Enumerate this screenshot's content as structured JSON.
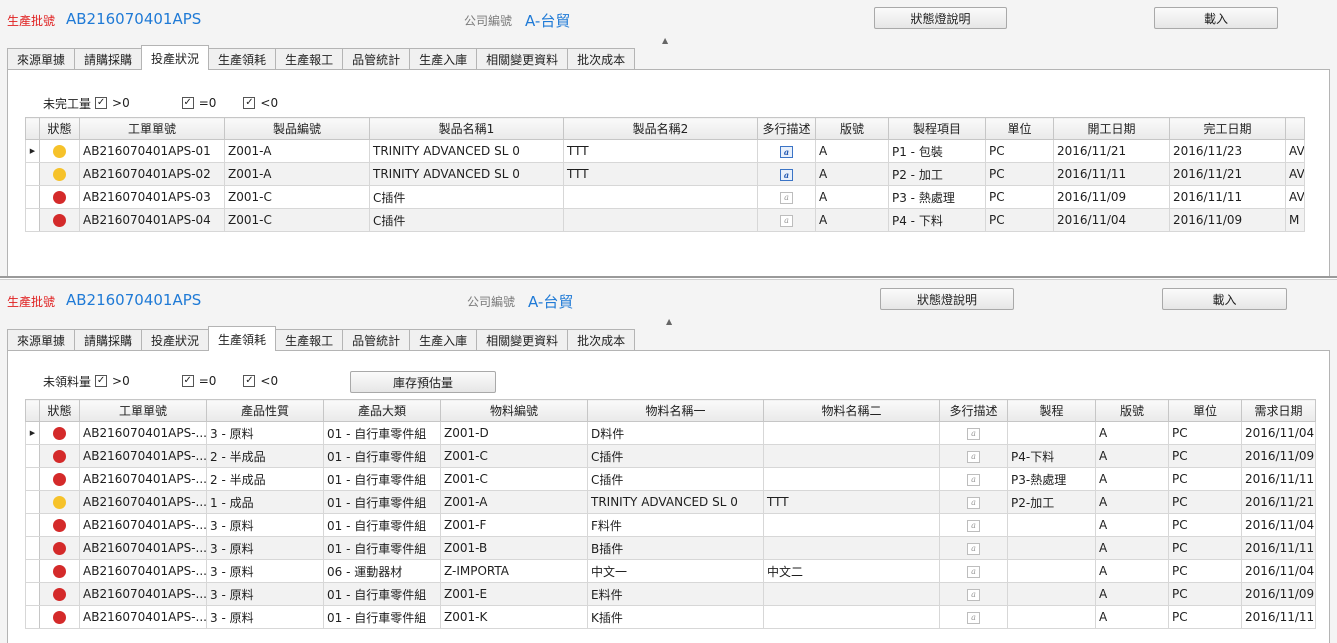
{
  "colors": {
    "red_label": "#e02020",
    "blue_value": "#1f7ad6",
    "status_red": "#d42a2a",
    "status_yellow": "#f6c22a"
  },
  "top": {
    "batch_label": "生產批號",
    "batch_value": "AB216070401APS",
    "company_label": "公司編號",
    "company_value": "A-台貿",
    "status_button": "狀態燈說明",
    "load_button": "載入",
    "tabs": [
      "來源單據",
      "請購採購",
      "投產狀況",
      "生產領耗",
      "生產報工",
      "品管統計",
      "生產入庫",
      "相關變更資料",
      "批次成本"
    ],
    "active_tab": 2,
    "filter": {
      "label": "未完工量",
      "opt1": ">0",
      "opt2": "=0",
      "opt3": "<0",
      "opt1_checked": true,
      "opt2_checked": true,
      "opt3_checked": true
    },
    "columns": [
      "狀態",
      "工單單號",
      "製品編號",
      "製品名稱1",
      "製品名稱2",
      "多行描述",
      "版號",
      "製程項目",
      "單位",
      "開工日期",
      "完工日期",
      ""
    ],
    "rows": [
      {
        "status": "yellow",
        "cells": [
          "AB216070401APS-01",
          "Z001-A",
          "TRINITY ADVANCED SL 0",
          "TTT",
          "A",
          "P1 - 包裝",
          "PC",
          "2016/11/21",
          "2016/11/23",
          "AV"
        ],
        "desc": "filled"
      },
      {
        "status": "yellow",
        "cells": [
          "AB216070401APS-02",
          "Z001-A",
          "TRINITY ADVANCED SL 0",
          "TTT",
          "A",
          "P2 - 加工",
          "PC",
          "2016/11/11",
          "2016/11/21",
          "AV"
        ],
        "desc": "filled"
      },
      {
        "status": "red",
        "cells": [
          "AB216070401APS-03",
          "Z001-C",
          "C插件",
          "",
          "A",
          "P3 - 熱處理",
          "PC",
          "2016/11/09",
          "2016/11/11",
          "AV"
        ],
        "desc": "empty"
      },
      {
        "status": "red",
        "cells": [
          "AB216070401APS-04",
          "Z001-C",
          "C插件",
          "",
          "A",
          "P4 - 下料",
          "PC",
          "2016/11/04",
          "2016/11/09",
          "M"
        ],
        "desc": "empty"
      }
    ]
  },
  "bottom": {
    "batch_label": "生產批號",
    "batch_value": "AB216070401APS",
    "company_label": "公司編號",
    "company_value": "A-台貿",
    "status_button": "狀態燈說明",
    "load_button": "載入",
    "tabs": [
      "來源單據",
      "請購採購",
      "投產狀況",
      "生產領耗",
      "生產報工",
      "品管統計",
      "生產入庫",
      "相關變更資料",
      "批次成本"
    ],
    "active_tab": 3,
    "filter": {
      "label": "未領料量",
      "opt1": ">0",
      "opt2": "=0",
      "opt3": "<0",
      "opt1_checked": true,
      "opt2_checked": true,
      "opt3_checked": true
    },
    "inventory_button": "庫存預估量",
    "columns": [
      "狀態",
      "工單單號",
      "產品性質",
      "產品大類",
      "物料編號",
      "物料名稱一",
      "物料名稱二",
      "多行描述",
      "製程",
      "版號",
      "單位",
      "需求日期"
    ],
    "rows": [
      {
        "status": "red",
        "cells": [
          "AB216070401APS-...",
          "3 - 原料",
          "01 - 自行車零件組",
          "Z001-D",
          "D料件",
          "",
          "",
          "A",
          "PC",
          "2016/11/04"
        ]
      },
      {
        "status": "red",
        "cells": [
          "AB216070401APS-...",
          "2 - 半成品",
          "01 - 自行車零件組",
          "Z001-C",
          "C插件",
          "",
          "P4-下料",
          "A",
          "PC",
          "2016/11/09"
        ]
      },
      {
        "status": "red",
        "cells": [
          "AB216070401APS-...",
          "2 - 半成品",
          "01 - 自行車零件組",
          "Z001-C",
          "C插件",
          "",
          "P3-熱處理",
          "A",
          "PC",
          "2016/11/11"
        ]
      },
      {
        "status": "yellow",
        "cells": [
          "AB216070401APS-...",
          "1 - 成品",
          "01 - 自行車零件組",
          "Z001-A",
          "TRINITY ADVANCED SL 0",
          "TTT",
          "P2-加工",
          "A",
          "PC",
          "2016/11/21"
        ]
      },
      {
        "status": "red",
        "cells": [
          "AB216070401APS-...",
          "3 - 原料",
          "01 - 自行車零件組",
          "Z001-F",
          "F料件",
          "",
          "",
          "A",
          "PC",
          "2016/11/04"
        ]
      },
      {
        "status": "red",
        "cells": [
          "AB216070401APS-...",
          "3 - 原料",
          "01 - 自行車零件組",
          "Z001-B",
          "B插件",
          "",
          "",
          "A",
          "PC",
          "2016/11/11"
        ]
      },
      {
        "status": "red",
        "cells": [
          "AB216070401APS-...",
          "3 - 原料",
          "06 - 運動器材",
          "Z-IMPORTA",
          "中文一",
          "中文二",
          "",
          "A",
          "PC",
          "2016/11/04"
        ]
      },
      {
        "status": "red",
        "cells": [
          "AB216070401APS-...",
          "3 - 原料",
          "01 - 自行車零件組",
          "Z001-E",
          "E料件",
          "",
          "",
          "A",
          "PC",
          "2016/11/09"
        ]
      },
      {
        "status": "red",
        "cells": [
          "AB216070401APS-...",
          "3 - 原料",
          "01 - 自行車零件組",
          "Z001-K",
          "K插件",
          "",
          "",
          "A",
          "PC",
          "2016/11/11"
        ]
      }
    ]
  }
}
